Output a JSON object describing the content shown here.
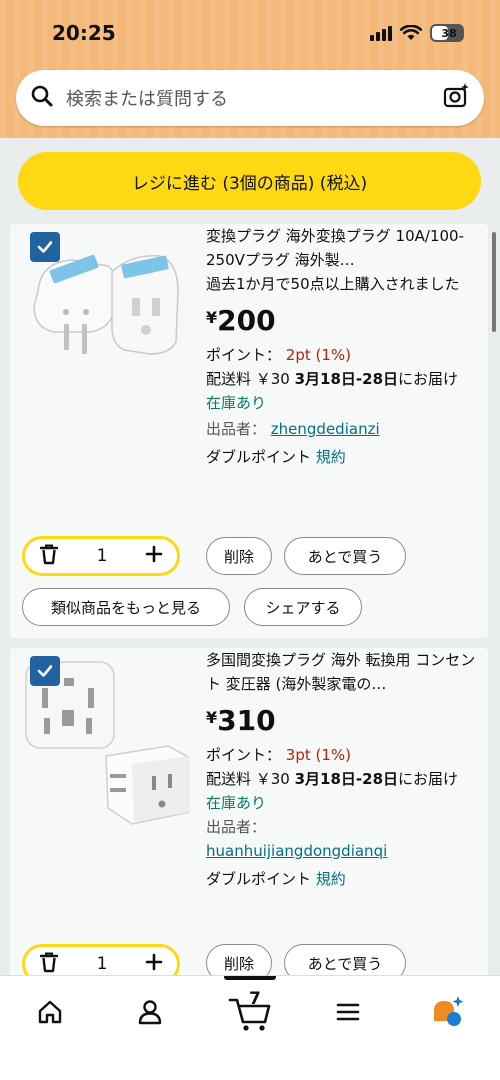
{
  "status": {
    "time": "20:25",
    "battery": "38"
  },
  "search": {
    "placeholder": "検索または質問する"
  },
  "checkout": {
    "label": "レジに進む (3個の商品) (税込)"
  },
  "items": [
    {
      "title": "変換プラグ 海外変換プラグ 10A/100-250Vプラグ 海外製…",
      "purchase_note": "過去1か月で50点以上購入されました",
      "yen": "¥",
      "price": "200",
      "points_label": "ポイント：",
      "points_value": "2pt (1%)",
      "shipping_prefix": "配送料 ￥30 ",
      "shipping_dates": "3月18日-28日",
      "shipping_suffix": "にお届け",
      "stock": "在庫あり",
      "seller_label": "出品者：",
      "seller": "zhengdedianzi",
      "double_points": "ダブルポイント",
      "terms": "規約",
      "qty": "1",
      "delete": "削除",
      "save_later": "あとで買う",
      "similar": "類似商品をもっと見る",
      "share": "シェアする"
    },
    {
      "title": "多国間変換プラグ 海外 転換用 コンセント 変圧器 (海外製家電の…",
      "yen": "¥",
      "price": "310",
      "points_label": "ポイント：",
      "points_value": "3pt (1%)",
      "shipping_prefix": "配送料 ￥30 ",
      "shipping_dates": "3月18日-28日",
      "shipping_suffix": "にお届け",
      "stock": "在庫あり",
      "seller_label": "出品者：",
      "seller": "huanhuijiangdongdianqi",
      "double_points": "ダブルポイント",
      "terms": "規約",
      "qty": "1",
      "delete": "削除",
      "save_later": "あとで買う"
    }
  ],
  "nav": {
    "cart_count": "7"
  },
  "colors": {
    "header": "#f3b87a",
    "checkout": "#ffd814",
    "link": "#007185",
    "checkbox": "#2162a1",
    "price_red": "#b12704",
    "stock_green": "#067d62"
  }
}
